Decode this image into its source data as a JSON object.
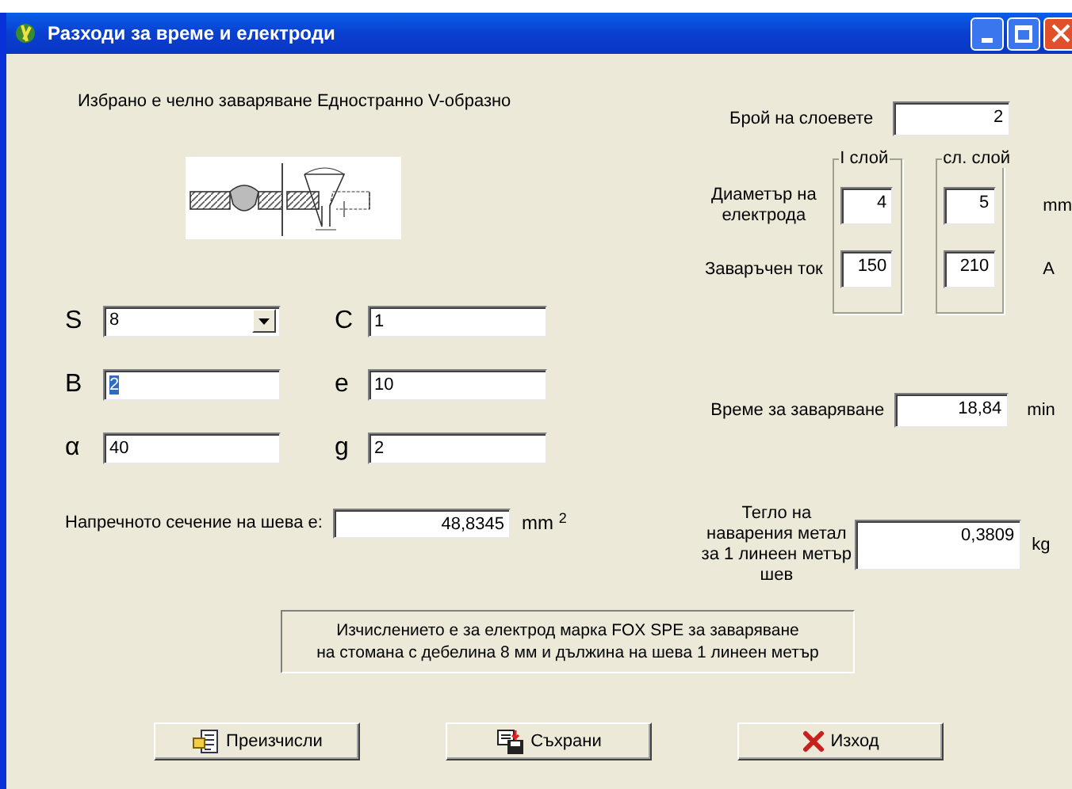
{
  "window": {
    "title": "Разходи за време и електроди"
  },
  "selection_text": "Избрано е  челно заваряване Едностранно V-образно",
  "layers": {
    "label": "Брой на слоевете",
    "value": "2"
  },
  "layer_groups": [
    {
      "title": "I слой"
    },
    {
      "title": "сл. слой"
    }
  ],
  "electrode_rows": [
    {
      "label": "Диаметър на електрода",
      "values": [
        "4",
        "5"
      ],
      "unit": "mm"
    },
    {
      "label": "Заваръчен ток",
      "values": [
        "150",
        "210"
      ],
      "unit": "A"
    }
  ],
  "params": [
    {
      "symbol": "S",
      "value": "8",
      "kind": "combo",
      "selected": false
    },
    {
      "symbol": "C",
      "value": "1",
      "kind": "text",
      "selected": false
    },
    {
      "symbol": "B",
      "value": "2",
      "kind": "text",
      "selected": true
    },
    {
      "symbol": "e",
      "value": "10",
      "kind": "text",
      "selected": false
    },
    {
      "symbol": "α",
      "value": "40",
      "kind": "text",
      "selected": false
    },
    {
      "symbol": "g",
      "value": "2",
      "kind": "text",
      "selected": false
    }
  ],
  "cross_section": {
    "label": "Напречното сечение на шева е:",
    "value": "48,8345",
    "unit": "mm $^{2}$"
  },
  "welding_time": {
    "label": "Време за заваряване",
    "value": "18,84",
    "unit": "min"
  },
  "weight": {
    "label": "Тегло на наварения метал за 1 линеен метър шев",
    "value": "0,3809",
    "unit": "kg"
  },
  "note": [
    "Изчислението е за електрод марка  FOX SPE за заваряване",
    "на стомана с дебелина 8 мм и дължина на шева 1 линеен метър"
  ],
  "buttons": [
    {
      "label": "Преизчисли",
      "kind": "recalc"
    },
    {
      "label": "Съхрани",
      "kind": "save"
    },
    {
      "label": "Изход",
      "kind": "exit"
    }
  ]
}
